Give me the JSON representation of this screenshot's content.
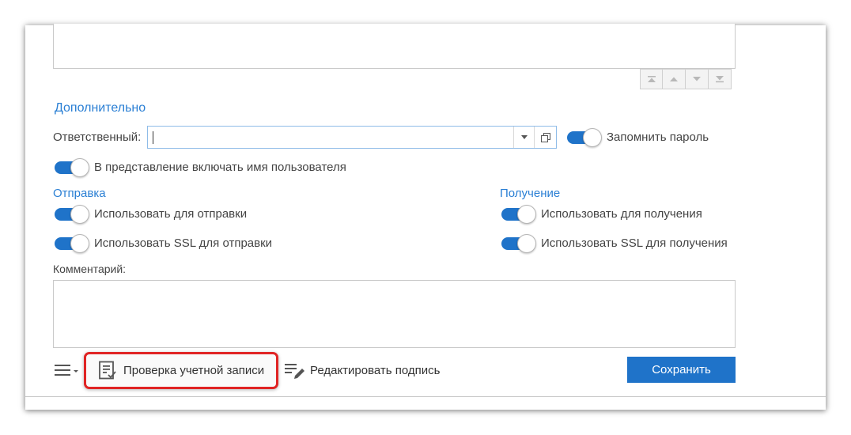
{
  "additional": {
    "title": "Дополнительно",
    "responsible_label": "Ответственный:",
    "responsible_value": "",
    "remember_password_label": "Запомнить пароль",
    "remember_password_on": true,
    "include_username_label": "В представление включать имя пользователя",
    "include_username_on": true
  },
  "sending": {
    "title": "Отправка",
    "use_label": "Использовать для отправки",
    "use_on": true,
    "ssl_label": "Использовать SSL для отправки",
    "ssl_on": true
  },
  "receiving": {
    "title": "Получение",
    "use_label": "Использовать для получения",
    "use_on": true,
    "ssl_label": "Использовать SSL для получения",
    "ssl_on": true
  },
  "comment": {
    "label": "Комментарий:",
    "value": ""
  },
  "toolbar": {
    "check_account_label": "Проверка учетной записи",
    "edit_signature_label": "Редактировать подпись",
    "save_label": "Сохранить"
  },
  "colors": {
    "accent": "#1f73c9",
    "section_title": "#2a7fd4",
    "highlight": "#e02424"
  }
}
